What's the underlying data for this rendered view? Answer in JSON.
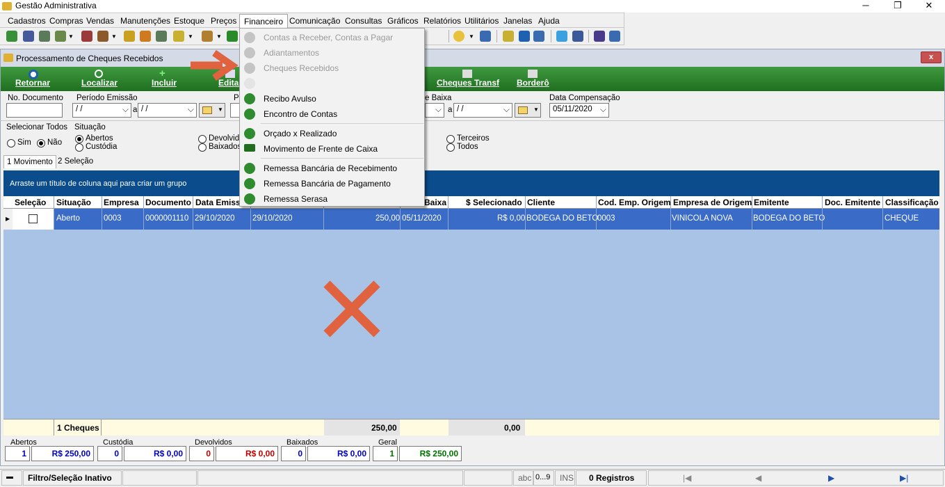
{
  "app": {
    "title": "Gestão Administrativa"
  },
  "menubar": {
    "items": [
      "Cadastros",
      "Compras",
      "Vendas",
      "Manutenções",
      "Estoque",
      "Preços",
      "Financeiro",
      "Comunicação",
      "Consultas",
      "Gráficos",
      "Relatórios",
      "Utilitários",
      "Janelas",
      "Ajuda"
    ]
  },
  "financeiro_menu": {
    "items": [
      {
        "label": "Contas a Receber, Contas a Pagar",
        "enabled": false
      },
      {
        "label": "Adiantamentos",
        "enabled": false
      },
      {
        "label": "Cheques Recebidos",
        "enabled": false
      },
      {
        "label": "",
        "enabled": false
      },
      {
        "label": "Recibo Avulso",
        "enabled": true
      },
      {
        "label": "Encontro de Contas",
        "enabled": true
      },
      {
        "label": "Orçado x Realizado",
        "enabled": true
      },
      {
        "label": "Movimento de Frente de Caixa",
        "enabled": true
      },
      {
        "label": "Remessa Bancária de Recebimento",
        "enabled": true
      },
      {
        "label": "Remessa Bancária de Pagamento",
        "enabled": true
      },
      {
        "label": "Remessa Serasa",
        "enabled": true
      }
    ]
  },
  "window": {
    "title": "Processamento de Cheques Recebidos",
    "close": "x"
  },
  "actions": {
    "retornar": "Retornar",
    "localizar": "Localizar",
    "incluir": "Incluir",
    "editar": "Editar",
    "cheques_transf": "Cheques Transf",
    "bordero": "Borderô"
  },
  "filters": {
    "no_documento_label": "No. Documento",
    "periodo_emissao_label": "Período Emissão",
    "periodo_de": " / /",
    "periodo_a_label": "a",
    "periodo_ate": " / /",
    "p_label": "P",
    "baixa_label": "e Baixa",
    "baixa_a_label": "a",
    "baixa_ate": " / /",
    "data_comp_label": "Data Compensação",
    "data_comp": "05/11/2020"
  },
  "options": {
    "selecionar_todos": "Selecionar Todos",
    "sim": "Sim",
    "nao": "Não",
    "situacao": "Situação",
    "abertos": "Abertos",
    "custodia": "Custódia",
    "devolvidos": "Devolvid",
    "baixados": "Baixados",
    "terceiros": "Terceiros",
    "todos": "Todos"
  },
  "tabs": {
    "movimento": "1 Movimento",
    "selecao": "2 Seleção"
  },
  "grid": {
    "group_hint": "Arraste um título de coluna aqui para criar um grupo",
    "headers": [
      "Seleção",
      "Situação",
      "Empresa",
      "Documento",
      "Data Emiss",
      "Baixa",
      "$ Selecionado",
      "Cliente",
      "Cod. Emp. Origem",
      "Empresa de Origem",
      "Emitente",
      "Doc. Emitente",
      "Classificação"
    ],
    "row": {
      "situacao": "Aberto",
      "empresa": "0003",
      "documento": "0000001110",
      "data_emissao": "29/10/2020",
      "data2": "29/10/2020",
      "valor": "250,00",
      "baixa": "05/11/2020",
      "selecionado": "R$ 0,00",
      "cliente": "BODEGA DO BETO",
      "cod_emp_origem": "0003",
      "empresa_origem": "VINICOLA NOVA",
      "emitente": "BODEGA DO BETO",
      "doc_emitente": "",
      "classificacao": "CHEQUE"
    },
    "footer": {
      "count": "1 Cheques",
      "total": "250,00",
      "selecionado": "0,00"
    }
  },
  "summary": {
    "abertos": {
      "label": "Abertos",
      "count": "1",
      "value": "R$ 250,00",
      "color": "#0000c0"
    },
    "custodia": {
      "label": "Custódia",
      "count": "0",
      "value": "R$ 0,00",
      "color": "#0000c0"
    },
    "devolvidos": {
      "label": "Devolvidos",
      "count": "0",
      "value": "R$ 0,00",
      "color": "#c00000"
    },
    "baixados": {
      "label": "Baixados",
      "count": "0",
      "value": "R$ 0,00",
      "color": "#0000c0"
    },
    "geral": {
      "label": "Geral",
      "count": "1",
      "value": "R$ 250,00",
      "color": "#007000"
    }
  },
  "statusbar": {
    "filtro": "Filtro/Seleção Inativo",
    "abc": "abc",
    "num": "0...9",
    "ins": "INS",
    "registros": "0 Registros"
  },
  "colors": {
    "accent_green": "#2a822a",
    "grid_blue": "#0b4c8c",
    "selected_row": "#3a6bc6",
    "annotation": "#e0623f"
  }
}
